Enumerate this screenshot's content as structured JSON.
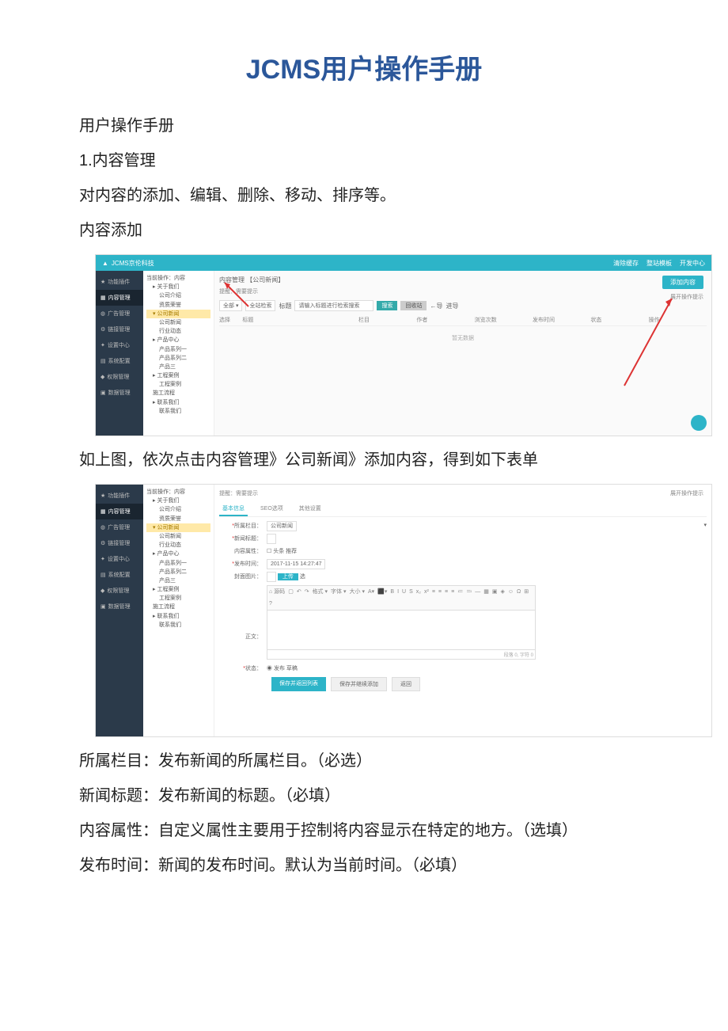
{
  "doc": {
    "title": "JCMS用户操作手册",
    "p1": "用户操作手册",
    "p2": "1.内容管理",
    "p3": "对内容的添加、编辑、删除、移动、排序等。",
    "p4": "内容添加",
    "p5": "如上图，依次点击内容管理》公司新闻》添加内容，得到如下表单",
    "p6": "所属栏目：发布新闻的所属栏目。（必选）",
    "p7": "新闻标题：发布新闻的标题。（必填）",
    "p8": "内容属性：自定义属性主要用于控制将内容显示在特定的地方。（选填）",
    "p9": "发布时间：新闻的发布时间。默认为当前时间。（必填）"
  },
  "ss1": {
    "brand": "JCMS京伦科技",
    "top_right": {
      "clear": "清除缓存",
      "info": "整站模板",
      "open": "开发中心"
    },
    "nav": [
      "功能插件",
      "内容管理",
      "广告管理",
      "链接管理",
      "设置中心",
      "系统配置",
      "权限管理",
      "数据管理"
    ],
    "tree_root": "当前操作：内容",
    "tree": [
      "关于我们",
      "公司介绍",
      "资质荣誉",
      "公司新闻",
      "公司新闻",
      "行业动态",
      "产品中心",
      "产品系列一",
      "产品系列二",
      "产品三",
      "工程案例",
      "工程案例",
      "施工流程",
      "联系我们",
      "联系我们"
    ],
    "crumb": "内容管理 【公司新闻】",
    "hint": "提醒：需要提示",
    "filter": {
      "sel": "全部",
      "loc": "全站检索",
      "kw_label": "标题",
      "kw_ph": "请输入标题进行检索搜索",
      "search": "搜索",
      "recycle": "回收站",
      "prev": "←导",
      "next": "进导"
    },
    "cols": [
      "选择",
      "标题",
      "栏目",
      "作者",
      "浏览次数",
      "发布时间",
      "状态",
      "操作"
    ],
    "nodata": "暂无数据",
    "add_btn": "添加内容",
    "add_hint": "展开操作提示"
  },
  "ss2": {
    "hint_top": "提醒：需要提示",
    "right_hint": "展开操作提示",
    "tabs": [
      "基本信息",
      "SEO选项",
      "其他设置"
    ],
    "form": {
      "col_label": "所属栏目：",
      "col_value": "公司新闻",
      "title_label": "新闻标题：",
      "attr_label": "内容属性：",
      "attr_opts": "头条  推荐",
      "time_label": "发布时间：",
      "time_value": "2017-11-15 14:27:47",
      "img_label": "封面图片：",
      "upload": "上传",
      "select": "选",
      "body_label": "正文：",
      "status_label": "状态：",
      "status_opts": "发布  草稿",
      "editor_counter": "段落 0, 字符 0"
    },
    "actions": {
      "save_back": "保存并返回列表",
      "save_add": "保存并继续添加",
      "back": "返回"
    }
  }
}
